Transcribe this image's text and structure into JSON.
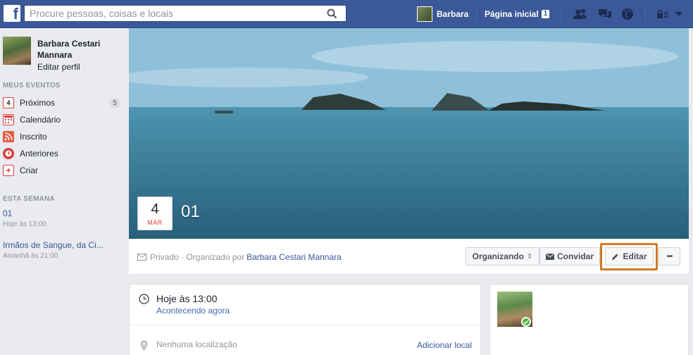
{
  "topbar": {
    "logo": "f",
    "search_placeholder": "Procure pessoas, coisas e locais",
    "user_name": "Barbara",
    "home_label": "Página inicial",
    "home_count": "1"
  },
  "sidebar": {
    "profile_name": "Barbara Cestari Mannara",
    "edit_profile": "Editar perfil",
    "my_events_title": "MEUS EVENTOS",
    "items": [
      {
        "label": "Próximos",
        "count": "5",
        "icon_text": "4"
      },
      {
        "label": "Calendário"
      },
      {
        "label": "Inscrito"
      },
      {
        "label": "Anteriores"
      },
      {
        "label": "Criar",
        "icon_text": "+"
      }
    ],
    "this_week_title": "ESTA SEMANA",
    "week_events": [
      {
        "title": "01",
        "time": "Hoje às 13:00"
      },
      {
        "title": "Irmãos de Sangue, da Ci...",
        "time": "Amanhã às 21:00"
      }
    ]
  },
  "cover": {
    "day": "4",
    "month": "MAR",
    "title": "01"
  },
  "action_bar": {
    "privacy": "Privado · Organizado por",
    "organizer": "Barbara Cestari Mannara",
    "organizing_label": "Organizando",
    "organizing_arrow": "⇕",
    "invite_label": "Convidar",
    "edit_label": "Editar",
    "more_label": "•••"
  },
  "details": {
    "time_main": "Hoje às 13:00",
    "time_sub": "Acontecendo agora",
    "location": "Nenhuma localização",
    "add_location": "Adicionar local"
  },
  "colors": {
    "brand": "#3b5998",
    "highlight": "#d07b22",
    "link": "#365899"
  }
}
